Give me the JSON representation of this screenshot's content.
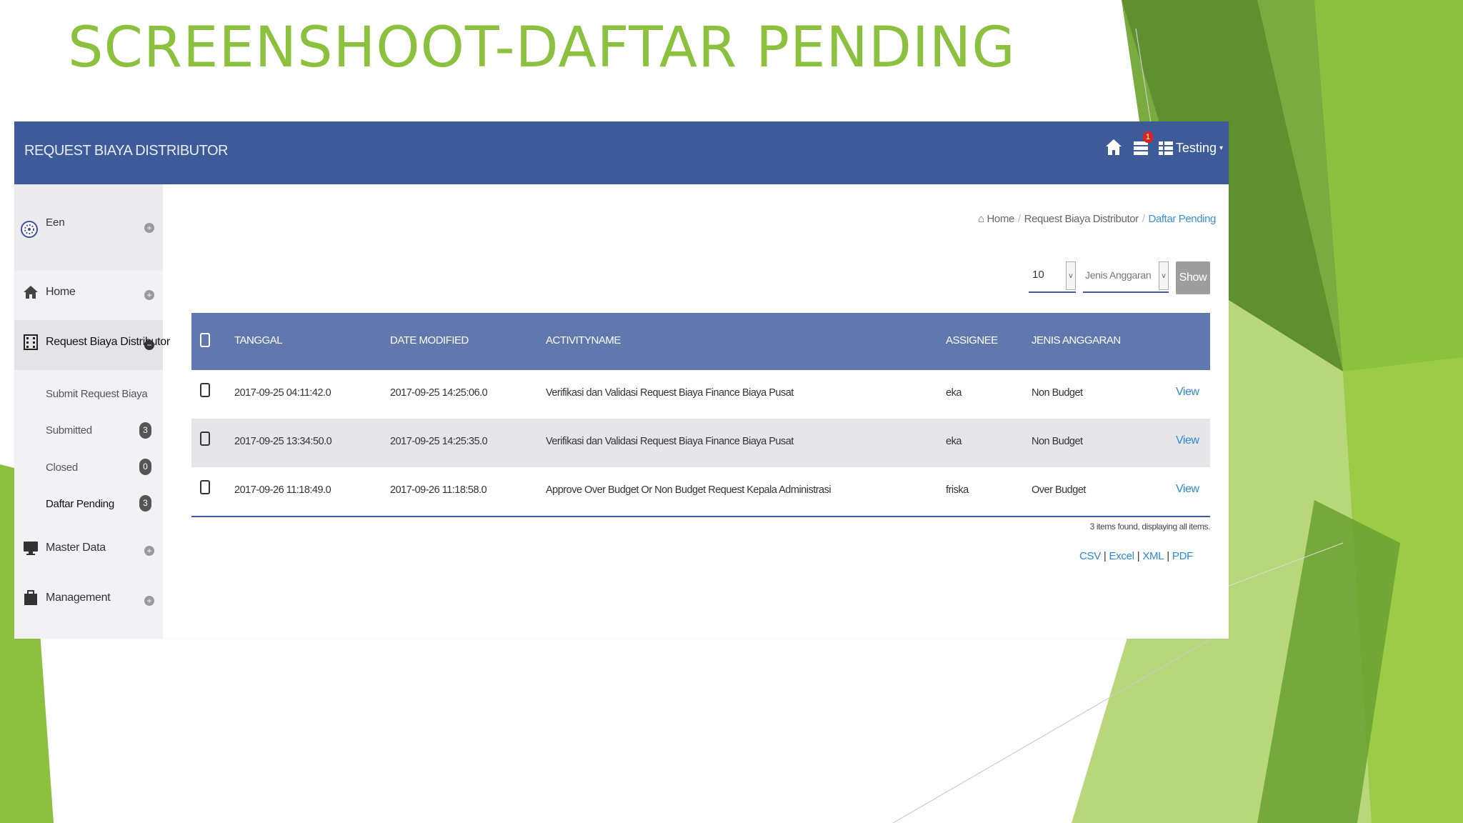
{
  "slide": {
    "title": "SCREENSHOOT-DAFTAR PENDING"
  },
  "app": {
    "brand": "REQUEST BIAYA DISTRIBUTOR",
    "nav": {
      "notification_count": "1",
      "user_label": "Testing"
    },
    "sidebar": {
      "profile_name": "Een",
      "items": [
        {
          "label": "Home",
          "icon": "home-icon"
        },
        {
          "label": "Request Biaya Distributor",
          "icon": "film-icon"
        },
        {
          "label": "Master Data",
          "icon": "monitor-icon"
        },
        {
          "label": "Management",
          "icon": "briefcase-icon"
        }
      ],
      "subitems": [
        {
          "label": "Submit Request Biaya",
          "count": ""
        },
        {
          "label": "Submitted",
          "count": "3"
        },
        {
          "label": "Closed",
          "count": "0"
        },
        {
          "label": "Daftar Pending",
          "count": "3"
        }
      ]
    },
    "breadcrumb": {
      "home": "Home",
      "section": "Request Biaya Distributor",
      "current": "Daftar Pending"
    },
    "filters": {
      "page_size": "10",
      "jenis_placeholder": "Jenis Anggaran",
      "show_label": "Show"
    },
    "table": {
      "headers": [
        "TANGGAL",
        "DATE MODIFIED",
        "ACTIVITYNAME",
        "ASSIGNEE",
        "JENIS ANGGARAN"
      ],
      "rows": [
        {
          "tanggal": "2017-09-25 04:11:42.0",
          "modified": "2017-09-25 14:25:06.0",
          "activity": "Verifikasi dan Validasi Request Biaya Finance Biaya Pusat",
          "assignee": "eka",
          "jenis": "Non Budget",
          "action": "View"
        },
        {
          "tanggal": "2017-09-25 13:34:50.0",
          "modified": "2017-09-25 14:25:35.0",
          "activity": "Verifikasi dan Validasi Request Biaya Finance Biaya Pusat",
          "assignee": "eka",
          "jenis": "Non Budget",
          "action": "View"
        },
        {
          "tanggal": "2017-09-26 11:18:49.0",
          "modified": "2017-09-26 11:18:58.0",
          "activity": "Approve Over Budget Or Non Budget Request Kepala Administrasi",
          "assignee": "friska",
          "jenis": "Over Budget",
          "action": "View"
        }
      ],
      "footer": "3 items found, displaying all items."
    },
    "exports": [
      "CSV",
      "Excel",
      "XML",
      "PDF"
    ]
  },
  "colors": {
    "title_green": "#8cc13f",
    "navbar_blue": "#3d5a99",
    "table_header_blue": "#6078ad",
    "link_blue": "#2f86d6"
  }
}
